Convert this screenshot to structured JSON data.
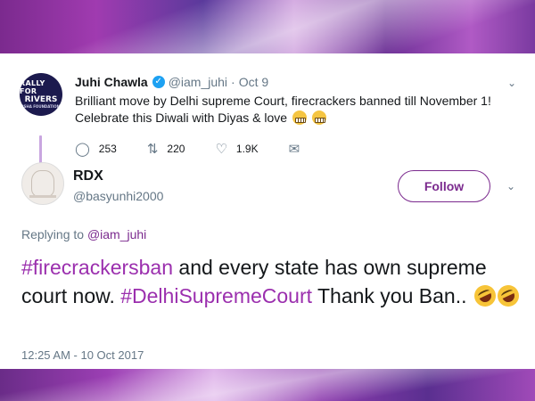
{
  "colors": {
    "accent": "#7b2a8e",
    "hashtag": "#9b2fae",
    "verified": "#1da1f2",
    "muted_text": "#657786",
    "main_text": "#14171a"
  },
  "original_tweet": {
    "avatar_text": [
      "RALLY FOR",
      "RIVERS",
      "ISHA FOUNDATION"
    ],
    "name": "Juhi Chawla",
    "handle": "@iam_juhi",
    "separator": "·",
    "date": "Oct 9",
    "caret": "⌄",
    "text": "Brilliant move by Delhi supreme Court, firecrackers banned till November 1! Celebrate this Diwali with Diyas & love",
    "emoji": [
      "grimacing-face",
      "grimacing-face"
    ],
    "actions": {
      "reply_icon": "reply-icon",
      "reply_count": "253",
      "retweet_icon": "retweet-icon",
      "retweet_count": "220",
      "like_icon": "heart-icon",
      "like_count": "1.9K",
      "dm_icon": "envelope-icon"
    }
  },
  "reply_tweet": {
    "name": "RDX",
    "handle": "@basyunhi2000",
    "follow_label": "Follow",
    "caret": "⌄",
    "replying_prefix": "Replying to",
    "replying_to": "@iam_juhi",
    "text_parts": {
      "hashtag1": "#firecrackersban",
      "text1": " and every state has own supreme court now. ",
      "hashtag2": "#DelhiSupremeCourt",
      "text2": " Thank you Ban.."
    },
    "emoji": [
      "rolling-on-floor-laughing",
      "rolling-on-floor-laughing"
    ],
    "timestamp": "12:25 AM - 10 Oct 2017"
  }
}
